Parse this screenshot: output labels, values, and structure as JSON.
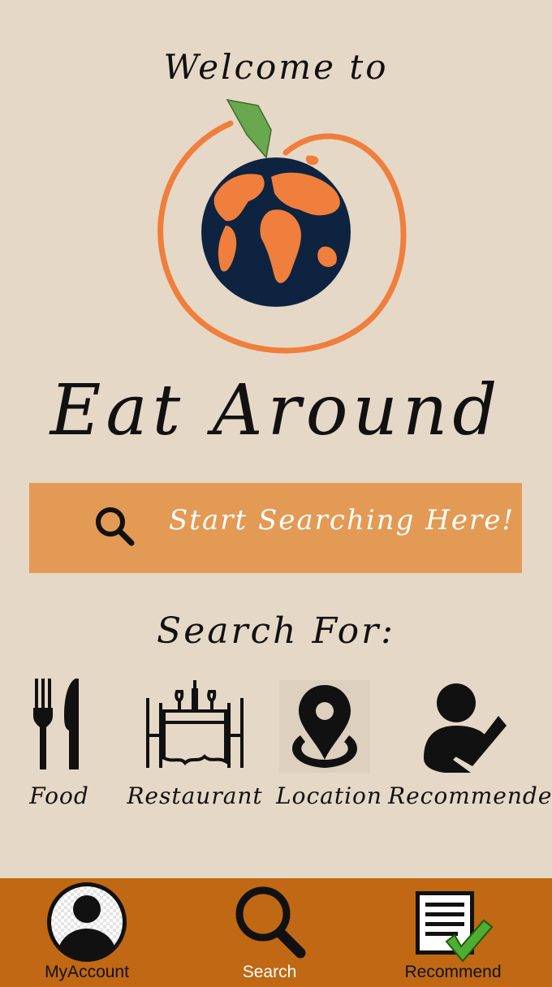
{
  "header": {
    "welcome": "Welcome to",
    "app_name": "Eat Around"
  },
  "logo": {
    "icon": "orange-globe-logo"
  },
  "search": {
    "placeholder": "Start Searching Here!",
    "icon": "search-icon"
  },
  "search_for": {
    "heading": "Search For:",
    "categories": [
      {
        "label": "Food",
        "icon": "fork-knife-icon"
      },
      {
        "label": "Restaurant",
        "icon": "dining-table-icon"
      },
      {
        "label": "Location",
        "icon": "location-pin-icon"
      },
      {
        "label": "Recommender",
        "icon": "recommender-check-icon"
      }
    ]
  },
  "bottom_nav": {
    "items": [
      {
        "label": "MyAccount",
        "icon": "account-icon"
      },
      {
        "label": "Search",
        "icon": "search-icon"
      },
      {
        "label": "Recommend",
        "icon": "recommend-checklist-icon"
      }
    ]
  },
  "colors": {
    "background": "#e6d8c6",
    "accent_orange": "#f07e3c",
    "search_bar": "#e39a54",
    "nav_bar": "#c06813",
    "globe_navy": "#0e2340",
    "leaf_green": "#6aa84f"
  }
}
